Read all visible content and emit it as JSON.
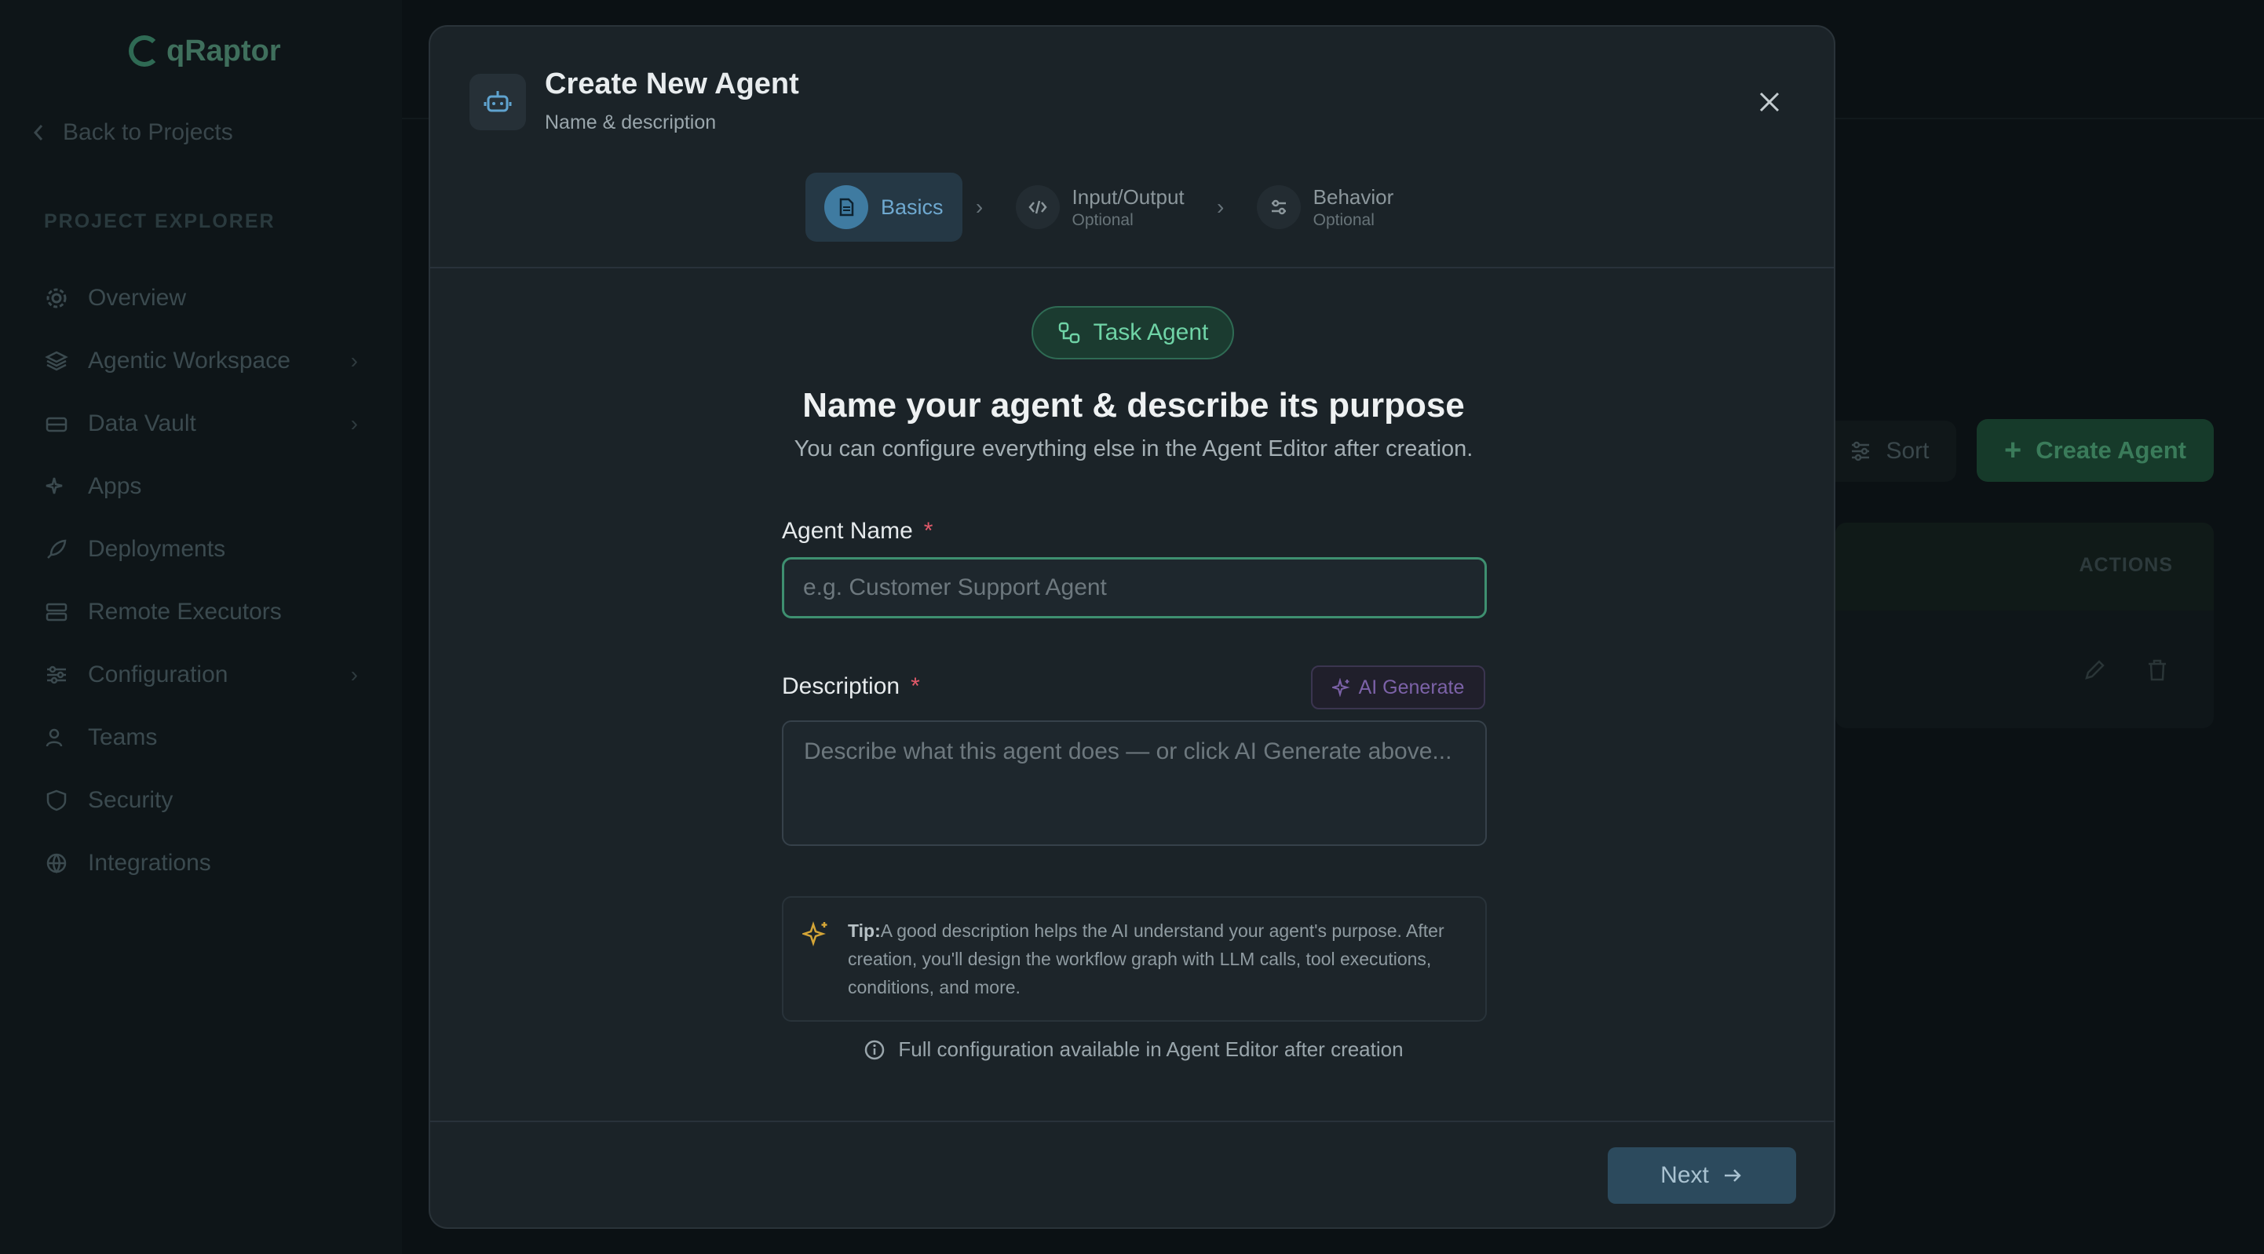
{
  "sidebar": {
    "logo_text": "qRaptor",
    "back_label": "Back to Projects",
    "section_label": "PROJECT EXPLORER",
    "items": [
      {
        "label": "Overview",
        "icon": "gear-icon"
      },
      {
        "label": "Agentic Workspace",
        "icon": "layers-icon",
        "chevron": true
      },
      {
        "label": "Data Vault",
        "icon": "vault-icon",
        "chevron": true
      },
      {
        "label": "Apps",
        "icon": "sparkles-icon"
      },
      {
        "label": "Deployments",
        "icon": "rocket-icon"
      },
      {
        "label": "Remote Executors",
        "icon": "server-icon"
      },
      {
        "label": "Configuration",
        "icon": "sliders-icon",
        "chevron": true
      },
      {
        "label": "Teams",
        "icon": "users-icon"
      },
      {
        "label": "Security",
        "icon": "shield-icon"
      },
      {
        "label": "Integrations",
        "icon": "globe-icon"
      }
    ]
  },
  "background": {
    "sort_label": "Sort",
    "create_agent_label": "Create Agent",
    "actions_header": "ACTIONS"
  },
  "modal": {
    "title": "Create New Agent",
    "subtitle": "Name & description",
    "steps": [
      {
        "label": "Basics",
        "sub": "",
        "active": true
      },
      {
        "label": "Input/Output",
        "sub": "Optional",
        "active": false
      },
      {
        "label": "Behavior",
        "sub": "Optional",
        "active": false
      }
    ],
    "badge": "Task Agent",
    "heading": "Name your agent & describe its purpose",
    "subheading": "You can configure everything else in the Agent Editor after creation.",
    "name_label": "Agent Name",
    "required_mark": "*",
    "name_placeholder": "e.g. Customer Support Agent",
    "name_value": "",
    "description_label": "Description",
    "ai_generate_label": "AI Generate",
    "description_placeholder": "Describe what this agent does — or click AI Generate above...",
    "tip_label": "Tip:",
    "tip_text": "A good description helps the AI understand your agent's purpose. After creation, you'll design the workflow graph with LLM calls, tool executions, conditions, and more.",
    "info_text": "Full configuration available in Agent Editor after creation",
    "next_label": "Next"
  },
  "colors": {
    "accent_green": "#3e8f70",
    "accent_blue": "#3f7ba1",
    "ai_purple": "#7c62a8",
    "tip_gold": "#d4a537",
    "required_red": "#e25a6a"
  }
}
